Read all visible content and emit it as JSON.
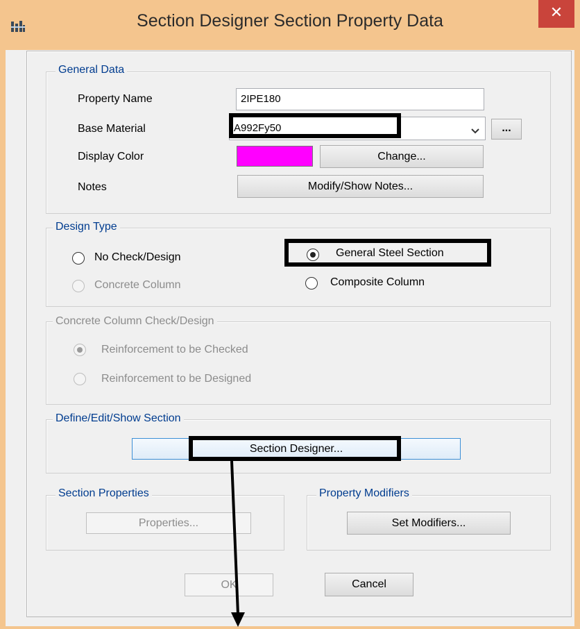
{
  "window": {
    "title": "Section Designer Section Property Data",
    "close_glyph": "✕",
    "app_icon": "etabs-app-icon"
  },
  "general_data": {
    "legend": "General Data",
    "property_name_label": "Property Name",
    "property_name_value": "2IPE180",
    "base_material_label": "Base Material",
    "base_material_value": "A992Fy50",
    "material_browse_label": "...",
    "display_color_label": "Display Color",
    "display_color_value": "#ff00ff",
    "change_label": "Change...",
    "notes_label": "Notes",
    "notes_button_label": "Modify/Show Notes..."
  },
  "design_type": {
    "legend": "Design Type",
    "no_check_label": "No Check/Design",
    "concrete_column_label": "Concrete Column",
    "general_steel_label": "General Steel Section",
    "composite_column_label": "Composite Column",
    "selected": "General Steel Section"
  },
  "concrete_check": {
    "legend": "Concrete Column Check/Design",
    "checked_label": "Reinforcement to be Checked",
    "designed_label": "Reinforcement to be Designed",
    "selected": "Reinforcement to be Checked"
  },
  "define_section": {
    "legend": "Define/Edit/Show Section",
    "section_designer_label": "Section Designer..."
  },
  "section_properties": {
    "legend": "Section Properties",
    "properties_button_label": "Properties..."
  },
  "property_modifiers": {
    "legend": "Property Modifiers",
    "set_modifiers_label": "Set Modifiers..."
  },
  "footer": {
    "ok_label": "OK",
    "cancel_label": "Cancel"
  },
  "colors": {
    "titlebar": "#f4c58e",
    "close": "#c9443b",
    "legend_text": "#003c8f",
    "annotation": "#000000"
  }
}
